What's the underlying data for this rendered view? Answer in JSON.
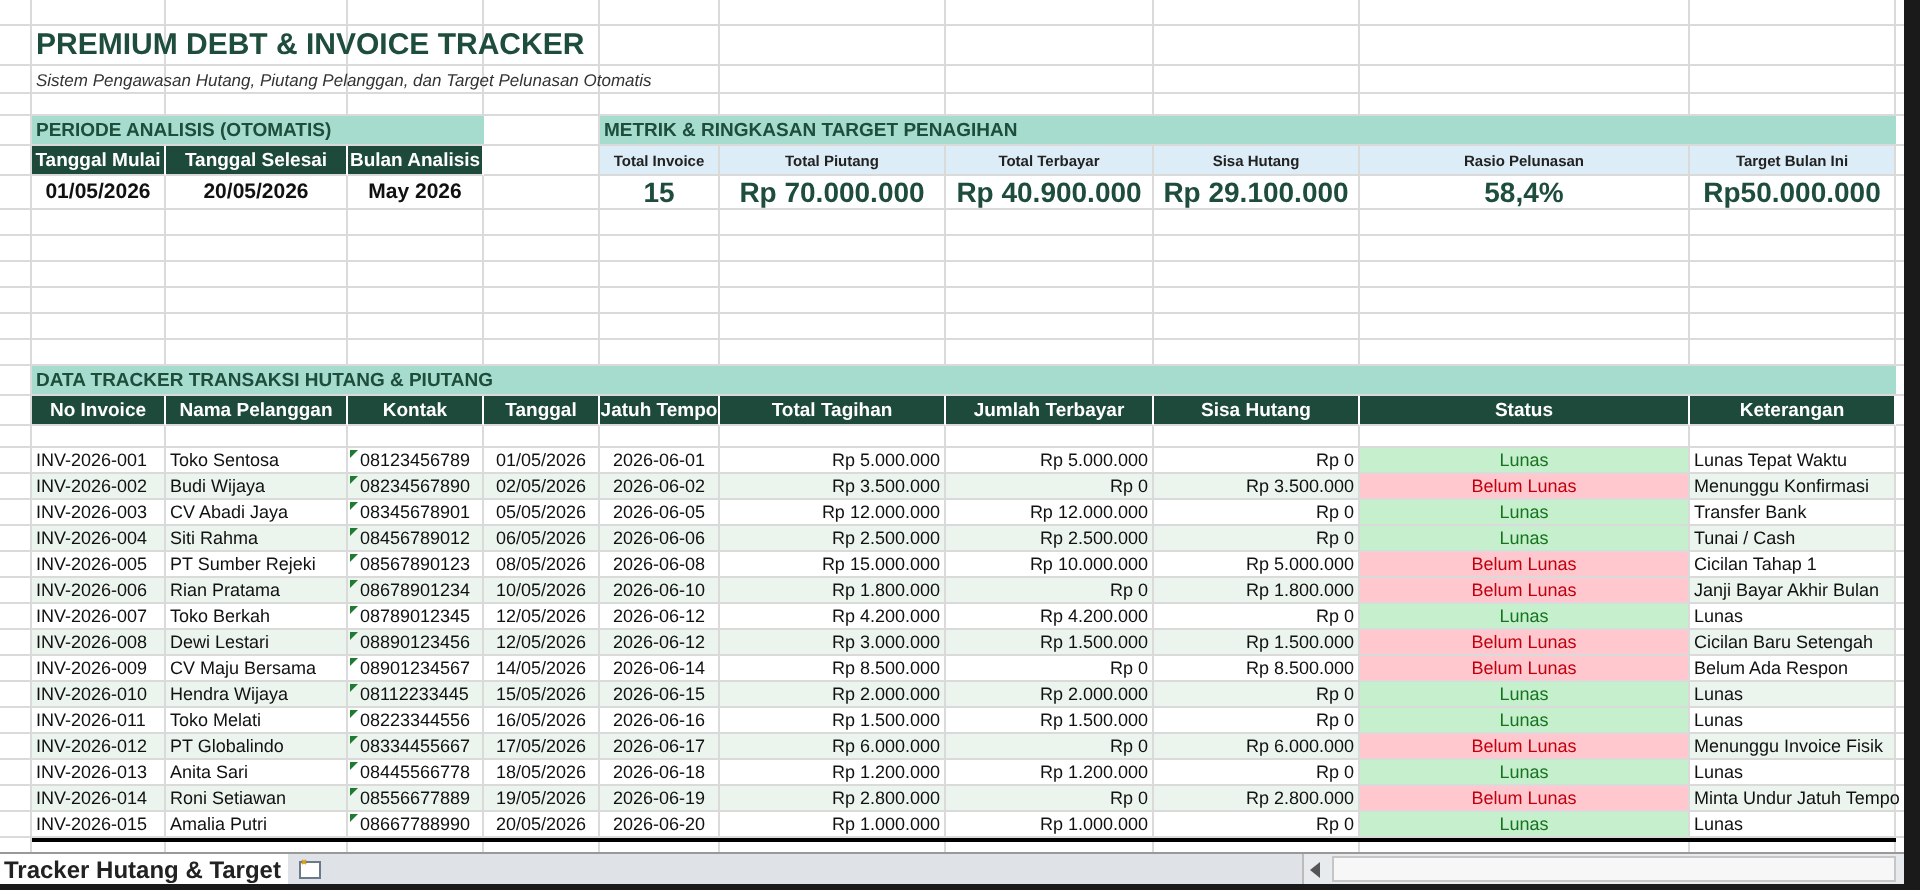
{
  "title": "PREMIUM DEBT & INVOICE TRACKER",
  "subtitle": "Sistem Pengawasan Hutang, Piutang Pelanggan, dan Target Pelunasan Otomatis",
  "period": {
    "heading": "PERIODE ANALISIS (OTOMATIS)",
    "columns": [
      "Tanggal Mulai",
      "Tanggal Selesai",
      "Bulan Analisis"
    ],
    "values": [
      "01/05/2026",
      "20/05/2026",
      "May 2026"
    ]
  },
  "metrics": {
    "heading": "METRIK & RINGKASAN TARGET PENAGIHAN",
    "items": [
      {
        "label": "Total Invoice",
        "value": "15"
      },
      {
        "label": "Total Piutang",
        "value": "Rp 70.000.000"
      },
      {
        "label": "Total Terbayar",
        "value": "Rp 40.900.000"
      },
      {
        "label": "Sisa Hutang",
        "value": "Rp 29.100.000"
      },
      {
        "label": "Rasio Pelunasan",
        "value": "58,4%"
      },
      {
        "label": "Target Bulan Ini",
        "value": "Rp50.000.000"
      }
    ]
  },
  "tracker": {
    "heading": "DATA TRACKER TRANSAKSI HUTANG & PIUTANG",
    "columns": [
      "No Invoice",
      "Nama Pelanggan",
      "Kontak",
      "Tanggal",
      "Jatuh Tempo",
      "Total Tagihan",
      "Jumlah Terbayar",
      "Sisa Hutang",
      "Status",
      "Keterangan"
    ],
    "rows": [
      {
        "invoice": "INV-2026-001",
        "customer": "Toko Sentosa",
        "contact": "08123456789",
        "date": "01/05/2026",
        "due": "2026-06-01",
        "total": "Rp 5.000.000",
        "paid_amount": "Rp 5.000.000",
        "remaining": "Rp 0",
        "status": "Lunas",
        "paid": true,
        "note": "Lunas Tepat Waktu"
      },
      {
        "invoice": "INV-2026-002",
        "customer": "Budi Wijaya",
        "contact": "08234567890",
        "date": "02/05/2026",
        "due": "2026-06-02",
        "total": "Rp 3.500.000",
        "paid_amount": "Rp 0",
        "remaining": "Rp 3.500.000",
        "status": "Belum Lunas",
        "paid": false,
        "note": "Menunggu Konfirmasi"
      },
      {
        "invoice": "INV-2026-003",
        "customer": "CV Abadi Jaya",
        "contact": "08345678901",
        "date": "05/05/2026",
        "due": "2026-06-05",
        "total": "Rp 12.000.000",
        "paid_amount": "Rp 12.000.000",
        "remaining": "Rp 0",
        "status": "Lunas",
        "paid": true,
        "note": "Transfer Bank"
      },
      {
        "invoice": "INV-2026-004",
        "customer": "Siti Rahma",
        "contact": "08456789012",
        "date": "06/05/2026",
        "due": "2026-06-06",
        "total": "Rp 2.500.000",
        "paid_amount": "Rp 2.500.000",
        "remaining": "Rp 0",
        "status": "Lunas",
        "paid": true,
        "note": "Tunai / Cash"
      },
      {
        "invoice": "INV-2026-005",
        "customer": "PT Sumber Rejeki",
        "contact": "08567890123",
        "date": "08/05/2026",
        "due": "2026-06-08",
        "total": "Rp 15.000.000",
        "paid_amount": "Rp 10.000.000",
        "remaining": "Rp 5.000.000",
        "status": "Belum Lunas",
        "paid": false,
        "note": "Cicilan Tahap 1"
      },
      {
        "invoice": "INV-2026-006",
        "customer": "Rian Pratama",
        "contact": "08678901234",
        "date": "10/05/2026",
        "due": "2026-06-10",
        "total": "Rp 1.800.000",
        "paid_amount": "Rp 0",
        "remaining": "Rp 1.800.000",
        "status": "Belum Lunas",
        "paid": false,
        "note": "Janji Bayar Akhir Bulan"
      },
      {
        "invoice": "INV-2026-007",
        "customer": "Toko Berkah",
        "contact": "08789012345",
        "date": "12/05/2026",
        "due": "2026-06-12",
        "total": "Rp 4.200.000",
        "paid_amount": "Rp 4.200.000",
        "remaining": "Rp 0",
        "status": "Lunas",
        "paid": true,
        "note": "Lunas"
      },
      {
        "invoice": "INV-2026-008",
        "customer": "Dewi Lestari",
        "contact": "08890123456",
        "date": "12/05/2026",
        "due": "2026-06-12",
        "total": "Rp 3.000.000",
        "paid_amount": "Rp 1.500.000",
        "remaining": "Rp 1.500.000",
        "status": "Belum Lunas",
        "paid": false,
        "note": "Cicilan Baru Setengah"
      },
      {
        "invoice": "INV-2026-009",
        "customer": "CV Maju Bersama",
        "contact": "08901234567",
        "date": "14/05/2026",
        "due": "2026-06-14",
        "total": "Rp 8.500.000",
        "paid_amount": "Rp 0",
        "remaining": "Rp 8.500.000",
        "status": "Belum Lunas",
        "paid": false,
        "note": "Belum Ada Respon"
      },
      {
        "invoice": "INV-2026-010",
        "customer": "Hendra Wijaya",
        "contact": "08112233445",
        "date": "15/05/2026",
        "due": "2026-06-15",
        "total": "Rp 2.000.000",
        "paid_amount": "Rp 2.000.000",
        "remaining": "Rp 0",
        "status": "Lunas",
        "paid": true,
        "note": "Lunas"
      },
      {
        "invoice": "INV-2026-011",
        "customer": "Toko Melati",
        "contact": "08223344556",
        "date": "16/05/2026",
        "due": "2026-06-16",
        "total": "Rp 1.500.000",
        "paid_amount": "Rp 1.500.000",
        "remaining": "Rp 0",
        "status": "Lunas",
        "paid": true,
        "note": "Lunas"
      },
      {
        "invoice": "INV-2026-012",
        "customer": "PT Globalindo",
        "contact": "08334455667",
        "date": "17/05/2026",
        "due": "2026-06-17",
        "total": "Rp 6.000.000",
        "paid_amount": "Rp 0",
        "remaining": "Rp 6.000.000",
        "status": "Belum Lunas",
        "paid": false,
        "note": "Menunggu Invoice Fisik"
      },
      {
        "invoice": "INV-2026-013",
        "customer": "Anita Sari",
        "contact": "08445566778",
        "date": "18/05/2026",
        "due": "2026-06-18",
        "total": "Rp 1.200.000",
        "paid_amount": "Rp 1.200.000",
        "remaining": "Rp 0",
        "status": "Lunas",
        "paid": true,
        "note": "Lunas"
      },
      {
        "invoice": "INV-2026-014",
        "customer": "Roni Setiawan",
        "contact": "08556677889",
        "date": "19/05/2026",
        "due": "2026-06-19",
        "total": "Rp 2.800.000",
        "paid_amount": "Rp 0",
        "remaining": "Rp 2.800.000",
        "status": "Belum Lunas",
        "paid": false,
        "note": "Minta Undur Jatuh Tempo"
      },
      {
        "invoice": "INV-2026-015",
        "customer": "Amalia Putri",
        "contact": "08667788990",
        "date": "20/05/2026",
        "due": "2026-06-20",
        "total": "Rp 1.000.000",
        "paid_amount": "Rp 1.000.000",
        "remaining": "Rp 0",
        "status": "Lunas",
        "paid": true,
        "note": "Lunas"
      }
    ]
  },
  "sheet_tabs": [
    {
      "label": "Tracker Hutang & Target",
      "selected": true
    }
  ]
}
